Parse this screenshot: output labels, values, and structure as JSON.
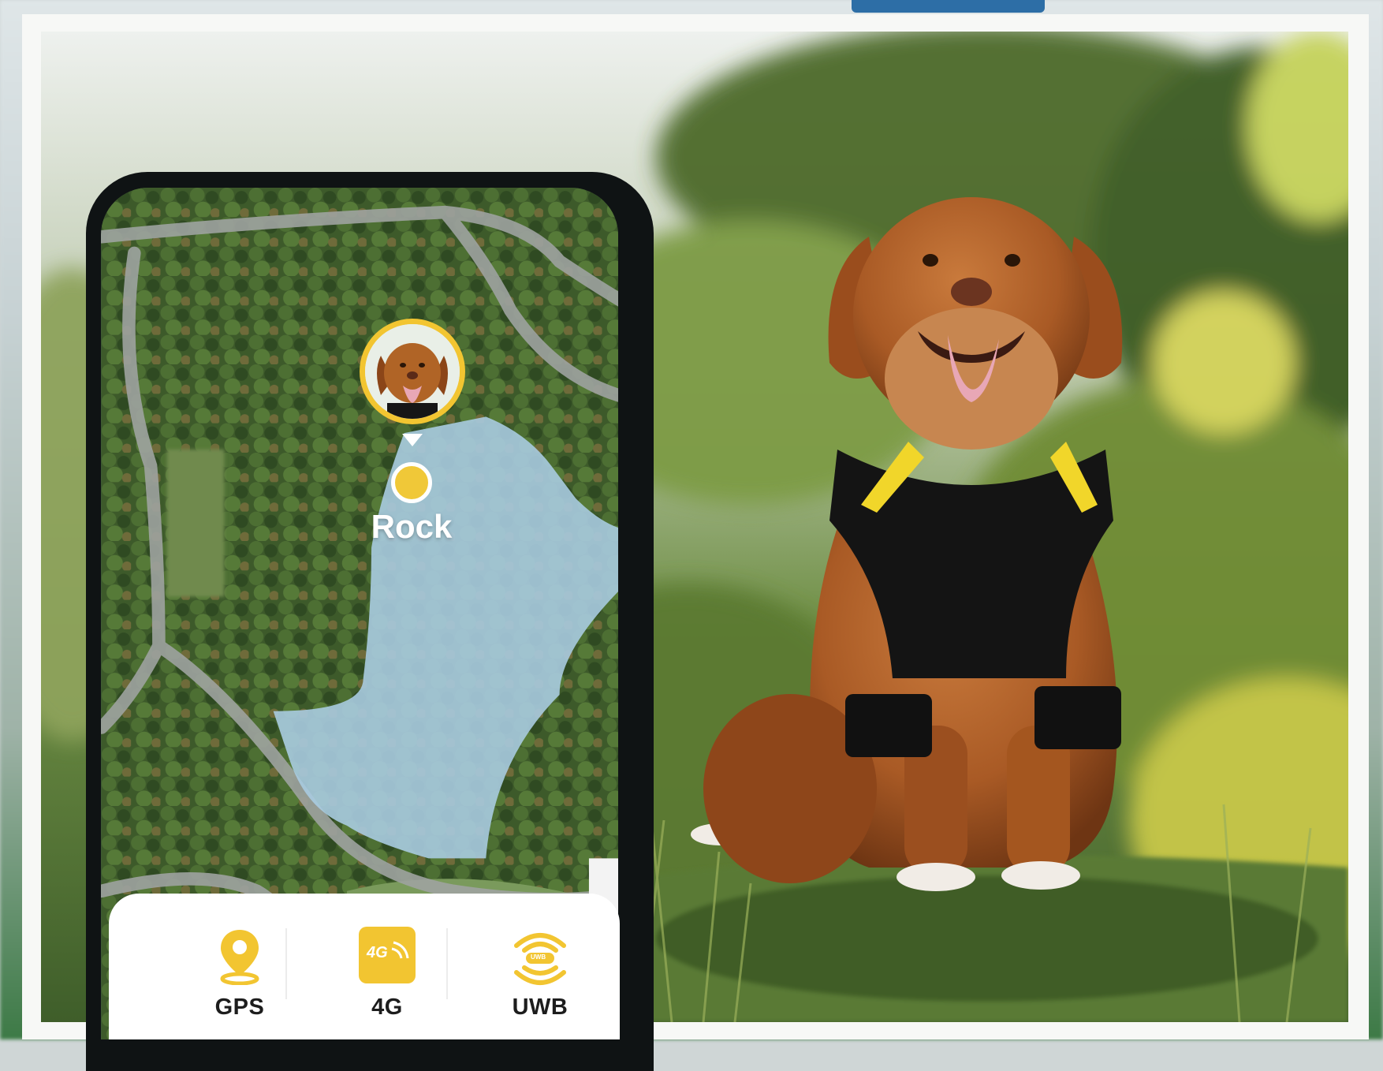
{
  "pet": {
    "name": "Rock"
  },
  "features": [
    {
      "label": "GPS",
      "icon": "location-pin-icon"
    },
    {
      "label": "4G",
      "icon": "4g-signal-icon",
      "badge": "4G"
    },
    {
      "label": "UWB",
      "icon": "uwb-signal-icon",
      "badge": "UWB"
    }
  ],
  "colors": {
    "accent": "#f2c531",
    "geofence": "#a9cbe0",
    "phone": "#0f1314",
    "card": "#ffffff"
  }
}
